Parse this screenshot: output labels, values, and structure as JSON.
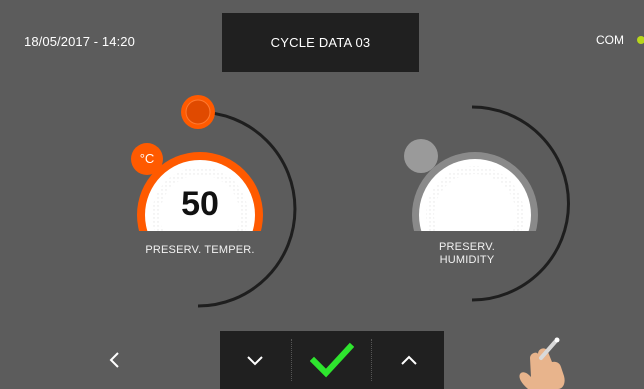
{
  "header": {
    "datetime": "18/05/2017 - 14:20",
    "title": "CYCLE DATA 03",
    "status_label": "COM",
    "status_color": "#b9d61b"
  },
  "dials": {
    "temperature": {
      "label": "PRESERV. TEMPER.",
      "value": "50",
      "unit": "°C",
      "accent": "#ff5a00"
    },
    "humidity": {
      "label_line1": "PRESERV.",
      "label_line2": "HUMIDITY",
      "accent": "#cfcfcf"
    }
  },
  "nav": {
    "back_icon": "chevron-left-icon",
    "down_icon": "chevron-down-icon",
    "confirm_icon": "check-icon",
    "up_icon": "chevron-up-icon",
    "confirm_color": "#2ee52e"
  },
  "hint_icon": "hand-pointer-icon"
}
